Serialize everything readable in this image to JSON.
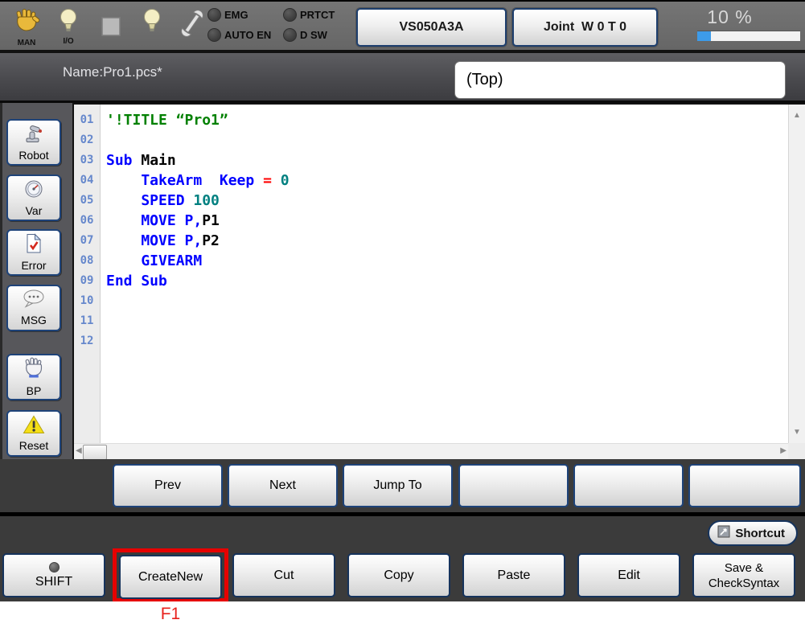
{
  "top_bar": {
    "man_label": "MAN",
    "io_label": "I/O",
    "leds": [
      {
        "label": "EMG"
      },
      {
        "label": "PRTCT"
      },
      {
        "label": "AUTO EN"
      },
      {
        "label": "D SW"
      }
    ],
    "robot_type_button": "VS050A3A",
    "joint_mode_button": "Joint  W 0 T 0",
    "speed_text": "10 %",
    "speed_percent": 13
  },
  "title_bar": {
    "program_name": "Name:Pro1.pcs*",
    "top_box_text": "(Top)"
  },
  "sidebar": {
    "items": [
      {
        "label": "Robot",
        "icon": "robot-arm-icon"
      },
      {
        "label": "Var",
        "icon": "gauge-icon"
      },
      {
        "label": "Error",
        "icon": "error-document-icon"
      },
      {
        "label": "MSG",
        "icon": "message-bubble-icon"
      },
      {
        "label": "BP",
        "icon": "hand-stop-icon"
      },
      {
        "label": "Reset",
        "icon": "warning-triangle-icon"
      }
    ]
  },
  "editor": {
    "lines": [
      {
        "num": "01",
        "tokens": [
          [
            "c",
            "'!TITLE “Pro1”"
          ]
        ]
      },
      {
        "num": "02",
        "tokens": []
      },
      {
        "num": "03",
        "tokens": [
          [
            "k",
            "Sub "
          ],
          [
            "p",
            "Main"
          ]
        ]
      },
      {
        "num": "04",
        "tokens": [
          [
            "k",
            "    TakeArm  Keep "
          ],
          [
            "o",
            "= "
          ],
          [
            "n",
            "0"
          ]
        ]
      },
      {
        "num": "05",
        "tokens": [
          [
            "k",
            "    SPEED "
          ],
          [
            "n",
            "100"
          ]
        ]
      },
      {
        "num": "06",
        "tokens": [
          [
            "k",
            "    MOVE P,"
          ],
          [
            "p",
            "P1"
          ]
        ]
      },
      {
        "num": "07",
        "tokens": [
          [
            "k",
            "    MOVE P,"
          ],
          [
            "p",
            "P2"
          ]
        ]
      },
      {
        "num": "08",
        "tokens": [
          [
            "k",
            "    GIVEARM"
          ]
        ]
      },
      {
        "num": "09",
        "tokens": [
          [
            "k",
            "End Sub"
          ]
        ]
      },
      {
        "num": "10",
        "tokens": []
      },
      {
        "num": "11",
        "tokens": []
      },
      {
        "num": "12",
        "tokens": []
      }
    ],
    "syntax_colors": {
      "comment": "#008000",
      "keyword": "#0000ff",
      "number": "#008080",
      "operator": "#ff0000",
      "plain": "#000000"
    }
  },
  "nav_row": {
    "buttons": [
      {
        "label": "Prev"
      },
      {
        "label": "Next"
      },
      {
        "label": "Jump To"
      },
      {
        "label": ""
      },
      {
        "label": ""
      },
      {
        "label": ""
      }
    ]
  },
  "bottom": {
    "shortcut_button": "Shortcut",
    "buttons": [
      {
        "label": "SHIFT"
      },
      {
        "label": "CreateNew"
      },
      {
        "label": "Cut"
      },
      {
        "label": "Copy"
      },
      {
        "label": "Paste"
      },
      {
        "label": "Edit"
      },
      {
        "label": "Save &",
        "label2": "CheckSyntax"
      }
    ],
    "fkey_label": "F1",
    "highlighted_button": "CreateNew"
  },
  "icons": {
    "man": "hand-icon",
    "io": "lightbulb-icon",
    "stop": "square-icon",
    "lamp": "lightbulb-icon",
    "tool": "wrench-icon",
    "shortcut": "edit-box-icon",
    "shift": "led-dot-icon"
  },
  "colors": {
    "button_border": "#1e4379",
    "highlight_red": "#e60000",
    "progress_fill": "#3d9be9",
    "panel_dark": "#3b3b3b",
    "top_bar_gray": "#6b6b6b"
  }
}
